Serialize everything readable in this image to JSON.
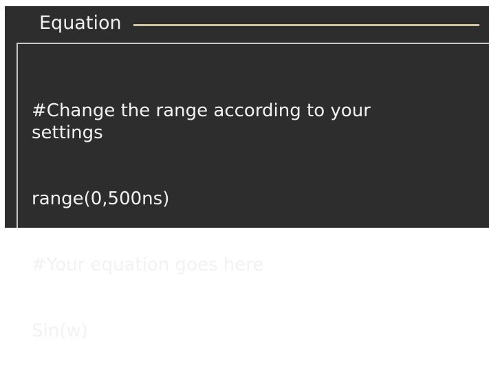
{
  "equation_group": {
    "title": "Equation",
    "accent_color": "#cfc4a2",
    "background_color": "#2d2d2d",
    "text_color": "#f2f2f2",
    "lines": [
      "#Change the range according to your settings",
      "range(0,500ns)",
      "#Your equation goes here",
      "Sin(w)"
    ]
  }
}
